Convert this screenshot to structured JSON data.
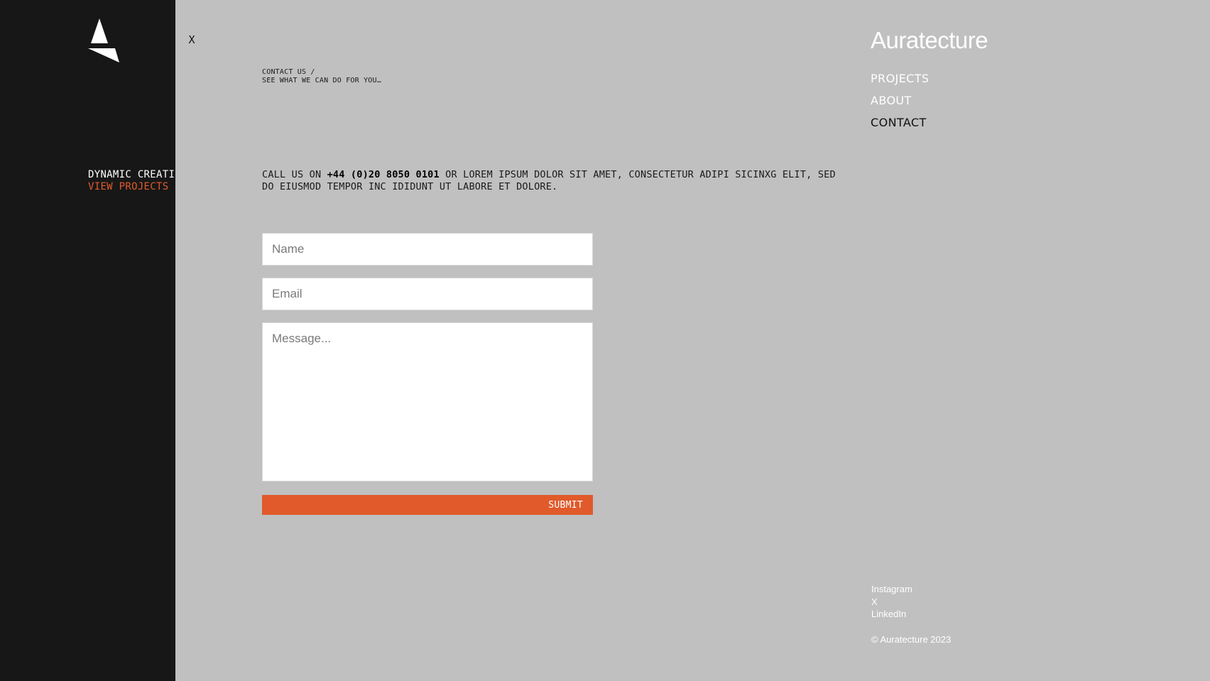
{
  "left_panel": {
    "logo_icon": "triangle-logo-icon",
    "hero_text": "DYNAMIC CREATIO",
    "view_projects": "VIEW PROJECTS"
  },
  "close_label": "X",
  "breadcrumb": {
    "line1": "CONTACT US /",
    "line2": "SEE WHAT WE CAN DO FOR YOU…"
  },
  "intro": {
    "prefix": "CALL US ON ",
    "phone": "+44 (0)20 8050 0101",
    "suffix": " OR LOREM IPSUM DOLOR SIT AMET, CONSECTETUR ADIPI SICINXG ELIT, SED DO EIUSMOD TEMPOR INC IDIDUNT UT LABORE ET DOLORE."
  },
  "form": {
    "name_placeholder": "Name",
    "email_placeholder": "Email",
    "message_placeholder": "Message...",
    "submit_label": "SUBMIT"
  },
  "brand": "Auratecture",
  "nav": {
    "items": [
      {
        "label": "PROJECTS"
      },
      {
        "label": "ABOUT"
      },
      {
        "label": "CONTACT"
      }
    ],
    "active": "CONTACT"
  },
  "social": {
    "instagram": "Instagram",
    "x": "X",
    "linkedin": "LinkedIn"
  },
  "copyright": "© Auratecture 2023",
  "colors": {
    "accent": "#e05a2b",
    "dark_panel": "#171717",
    "background": "#c0c0c0"
  }
}
